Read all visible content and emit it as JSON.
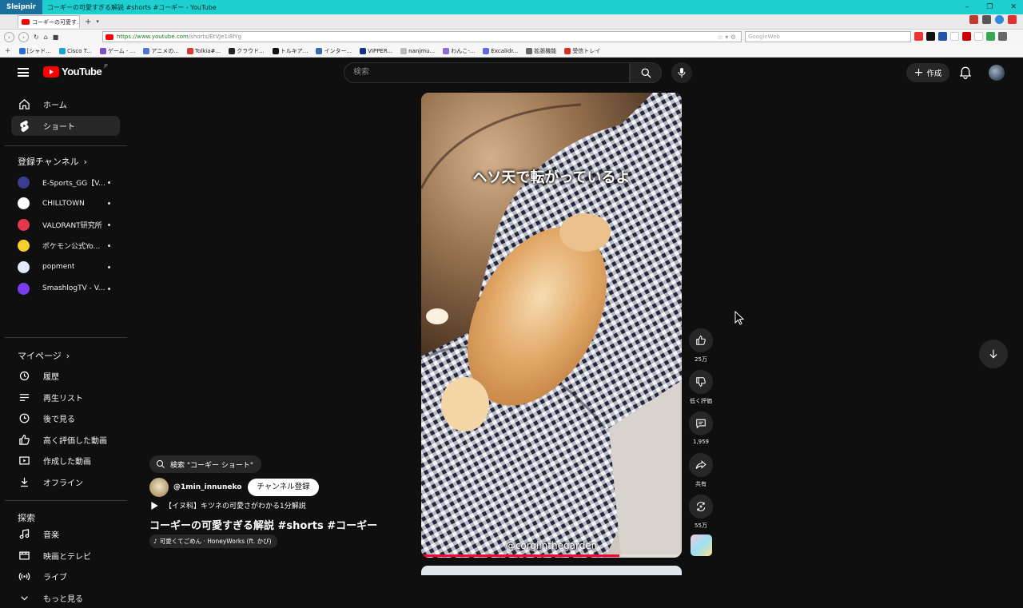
{
  "window": {
    "app_name": "Sleipnir",
    "title": "コーギーの可愛すぎる解説 #shorts #コーギー - YouTube",
    "tab_label": "コーギーの可愛す..."
  },
  "browser": {
    "url_host": "https://www.youtube.com",
    "url_path": "/shorts/EtVJe1i8lYg",
    "search_placeholder": "GoogleWeb",
    "bookmarks": [
      {
        "label": "[シャド...",
        "color": "#2b6cd4"
      },
      {
        "label": "Cisco T...",
        "color": "#1ba0d7"
      },
      {
        "label": "ゲーム - ...",
        "color": "#7a4fc9"
      },
      {
        "label": "アニメの...",
        "color": "#4f7acb"
      },
      {
        "label": "Tolkia#...",
        "color": "#d83a3a"
      },
      {
        "label": "クラウド...",
        "color": "#222222"
      },
      {
        "label": "トルキア...",
        "color": "#111111"
      },
      {
        "label": "インター...",
        "color": "#3b6ab5"
      },
      {
        "label": "VIPPER...",
        "color": "#16307a"
      },
      {
        "label": "nanjmu...",
        "color": "#bbbbbb"
      },
      {
        "label": "わんこ-...",
        "color": "#8f6bd9"
      },
      {
        "label": "Excalidr...",
        "color": "#6965db"
      },
      {
        "label": "拡張機能",
        "color": "#666666"
      },
      {
        "label": "受信トレイ",
        "color": "#d93025"
      }
    ]
  },
  "youtube": {
    "logo_text": "YouTube",
    "logo_region": "JP",
    "search_placeholder": "検索",
    "create_label": "作成",
    "sidebar": {
      "main": [
        {
          "label": "ホーム",
          "icon": "home-icon"
        },
        {
          "label": "ショート",
          "icon": "shorts-icon",
          "active": true
        }
      ],
      "subscriptions_title": "登録チャンネル",
      "channels": [
        {
          "name": "E-Sports_GG【V...",
          "color": "#3b3b8f"
        },
        {
          "name": "CHILLTOWN",
          "color": "#ffffff"
        },
        {
          "name": "VALORANT研究所",
          "color": "#e23a4a"
        },
        {
          "name": "ポケモン公式Yo...",
          "color": "#f2cf2a"
        },
        {
          "name": "popment",
          "color": "#dfe9f7"
        },
        {
          "name": "SmashlogTV - V...",
          "color": "#7a3cf0"
        }
      ],
      "you_title": "マイページ",
      "you_items": [
        {
          "label": "履歴",
          "icon": "history-icon"
        },
        {
          "label": "再生リスト",
          "icon": "playlist-icon"
        },
        {
          "label": "後で見る",
          "icon": "watch-later-icon"
        },
        {
          "label": "高く評価した動画",
          "icon": "liked-icon"
        },
        {
          "label": "作成した動画",
          "icon": "your-videos-icon"
        },
        {
          "label": "オフライン",
          "icon": "download-icon"
        }
      ],
      "explore_title": "探索",
      "explore_items": [
        {
          "label": "音楽",
          "icon": "music-icon"
        },
        {
          "label": "映画とテレビ",
          "icon": "movies-icon"
        },
        {
          "label": "ライブ",
          "icon": "live-icon"
        },
        {
          "label": "もっと見る",
          "icon": "chevron-down-icon"
        }
      ]
    },
    "short": {
      "caption": "ヘソ天で転がっているよ",
      "watermark": "@corgiinthegarden",
      "progress": 0.76,
      "search_chip": "検索 \"コーギー ショート\"",
      "channel": "@1min_innuneko",
      "subscribe_label": "チャンネル登録",
      "related_video": "【イヌ科】キツネの可愛さがわかる1分解説",
      "title": "コーギーの可愛すぎる解説 #shorts #コーギー",
      "music": "可愛くてごめん · HoneyWorks (ft. かぴ)",
      "actions": {
        "likes": "25万",
        "dislike_label": "低く評価",
        "comments": "1,959",
        "share_label": "共有",
        "remix": "55万"
      }
    }
  }
}
